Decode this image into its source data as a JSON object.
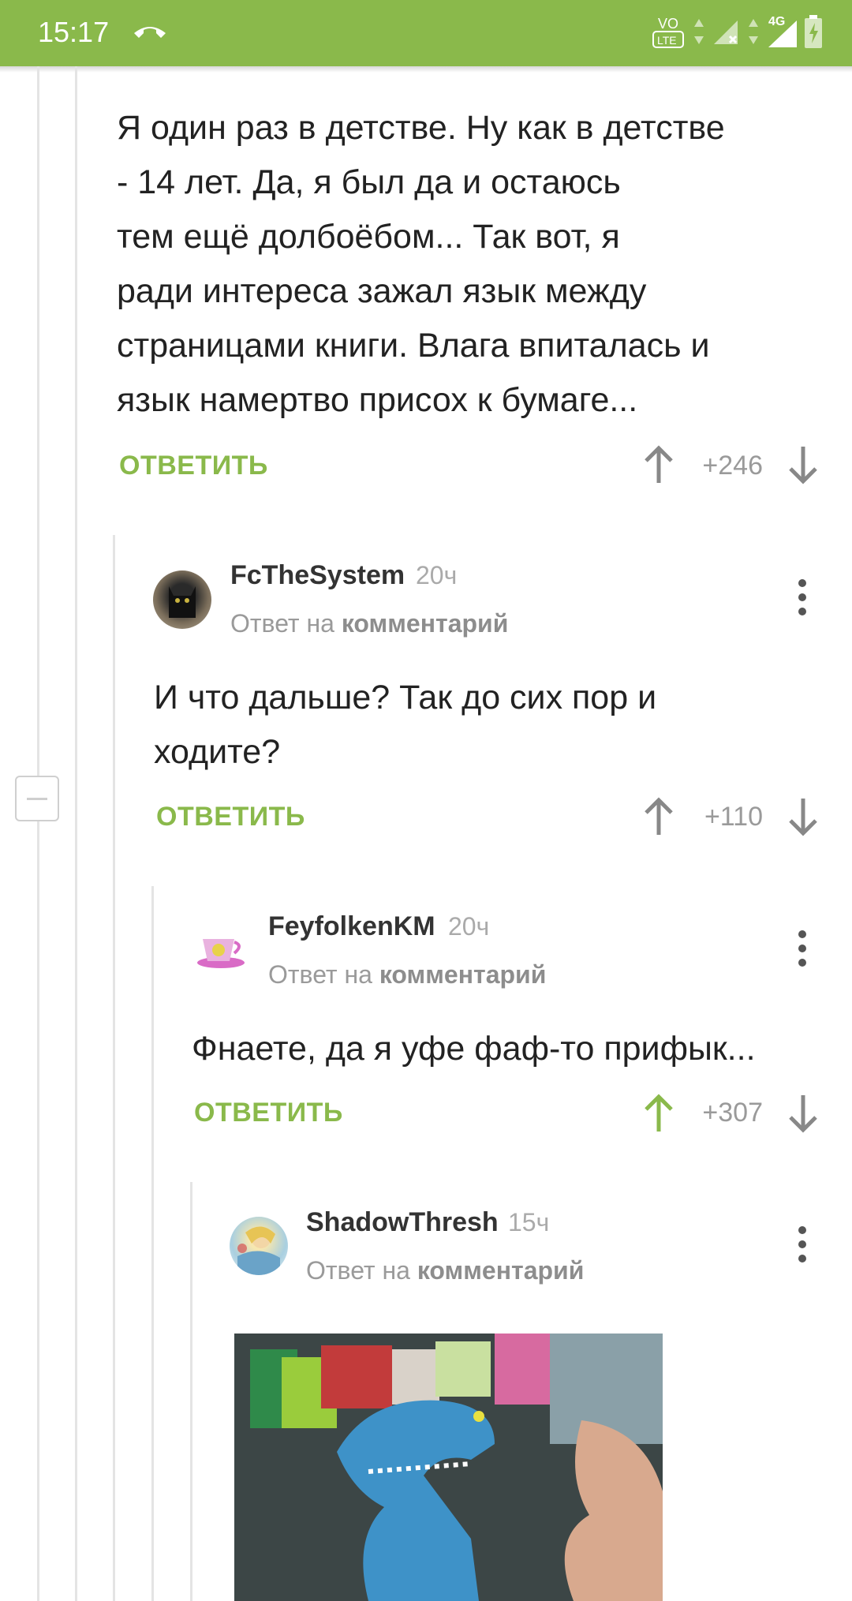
{
  "status_bar": {
    "time": "15:17",
    "lte_label": "LTE",
    "network_label": "4G"
  },
  "comments": [
    {
      "text": "Я один раз в детстве. Ну как в детстве - 14 лет. Да, я был да и остаюсь тем ещё долбоёбом... Так вот, я ради интереса зажал язык между страницами книги. Влага впиталась и язык намертво присох к бумаге...",
      "lines": [
        "Я один раз в детстве. Ну как в детстве",
        "- 14 лет. Да, я был да и остаюсь",
        "тем ещё долбоёбом... Так вот, я",
        "ради интереса зажал язык между",
        "страницами книги. Влага впиталась и",
        "язык намертво присох к бумаге..."
      ],
      "reply_label": "ОТВЕТИТЬ",
      "score": "+246"
    },
    {
      "username": "FcTheSystem",
      "time": "20ч",
      "reply_to_prefix": "Ответ на",
      "reply_to_link": "комментарий",
      "lines": [
        "И что дальше? Так до сих пор и",
        "ходите?"
      ],
      "reply_label": "ОТВЕТИТЬ",
      "score": "+110"
    },
    {
      "username": "FeyfolkenKM",
      "time": "20ч",
      "reply_to_prefix": "Ответ на",
      "reply_to_link": "комментарий",
      "lines": [
        "Фнаете, да я уфе фаф-то прифык..."
      ],
      "reply_label": "ОТВЕТИТЬ",
      "score": "+307"
    },
    {
      "username": "ShadowThresh",
      "time": "15ч",
      "reply_to_prefix": "Ответ на",
      "reply_to_link": "комментарий"
    }
  ],
  "colors": {
    "accent": "#8ab94b",
    "upvoted": "#8ab94b",
    "neutral_arrow": "#888888"
  }
}
